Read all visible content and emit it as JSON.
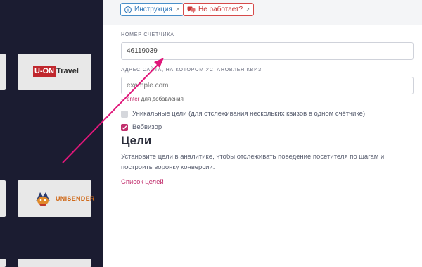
{
  "sidebar": {
    "logos": [
      {
        "name": "U-ON Travel",
        "part1": "U-ON",
        "part2": "Travel"
      },
      {
        "name": "UNISENDER",
        "text": "UNISENDER"
      }
    ]
  },
  "topbar": {
    "help_label": "Инструкция",
    "error_label": "Не работает?"
  },
  "form": {
    "counter_label": "НОМЕР СЧЁТЧИКА",
    "counter_value": "46119039",
    "site_label": "АДРЕС САЙТА, НА КОТОРОМ УСТАНОВЛЕН КВИЗ",
    "site_placeholder": "example.com",
    "hint_enter": "enter",
    "hint_rest": " для добавления",
    "unique_goals_label": "Уникальные цели (для отслеживания нескольких квизов в одном счётчике)",
    "unique_goals_checked": false,
    "webvisor_label": "Вебвизор",
    "webvisor_checked": true
  },
  "goals": {
    "title": "Цели",
    "description": "Установите цели в аналитике, чтобы отслеживать поведение посетителя по шагам и построить воронку конверсии.",
    "link_label": "Список целей"
  },
  "colors": {
    "accent": "#c2306e",
    "dark_bg": "#1b1c31",
    "help_blue": "#2f76b8",
    "error_red": "#c93636"
  }
}
